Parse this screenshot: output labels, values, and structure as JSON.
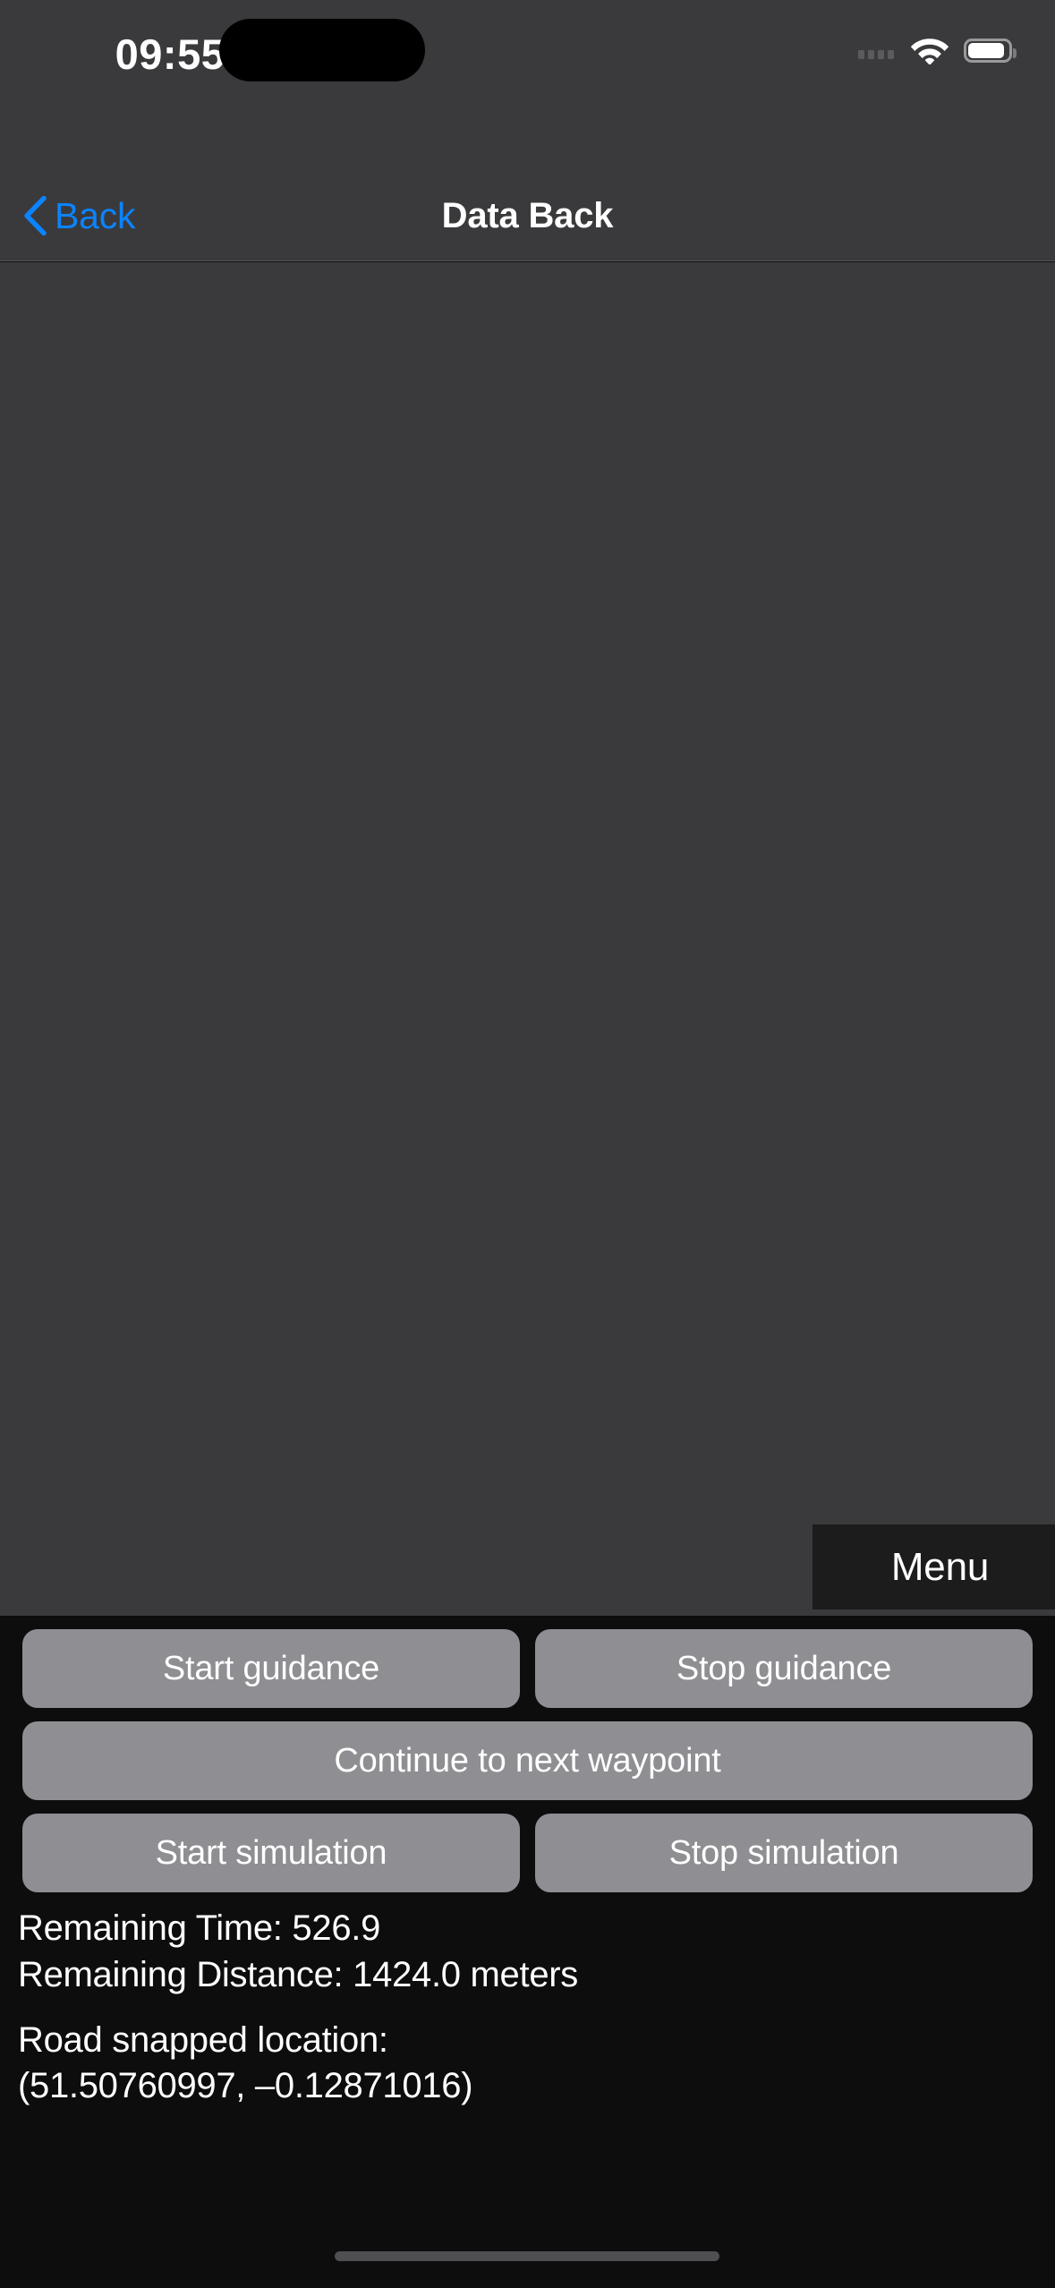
{
  "status_bar": {
    "time": "09:55",
    "icons": {
      "cellular": "signal-dots-icon",
      "wifi": "wifi-icon",
      "battery": "battery-full-icon"
    }
  },
  "nav_bar": {
    "back_label": "Back",
    "back_icon": "chevron-left-icon",
    "title": "Data Back"
  },
  "map": {
    "menu_label": "Menu"
  },
  "controls": {
    "row1": [
      {
        "label": "Start guidance"
      },
      {
        "label": "Stop guidance"
      }
    ],
    "row2": [
      {
        "label": "Continue to next waypoint"
      }
    ],
    "row3": [
      {
        "label": "Start simulation"
      },
      {
        "label": "Stop simulation"
      }
    ]
  },
  "info": {
    "remaining_time": "Remaining Time: 526.9",
    "remaining_distance": "Remaining Distance: 1424.0 meters",
    "road_snapped_location": "Road snapped location: (51.50760997, –0.12871016)"
  },
  "colors": {
    "accent": "#0a84ff",
    "map_background": "#3a3a3c",
    "panel_background": "#0d0d0d",
    "button_fill": "#8e8e93",
    "menu_fill": "#1c1c1c"
  }
}
